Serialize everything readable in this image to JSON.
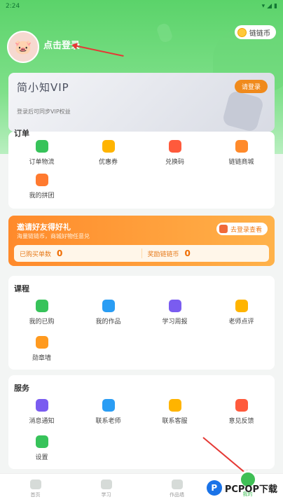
{
  "status": {
    "time": "2:24"
  },
  "header": {
    "login_text": "点击登录",
    "coin_label": "链链币"
  },
  "vip": {
    "title": "简小知VIP",
    "subtitle": "登录后可同步VIP权益",
    "button": "请登录"
  },
  "orders": {
    "title": "订单",
    "items": [
      {
        "label": "订单物流",
        "icon": "order-logistics-icon",
        "color": "#37c35a"
      },
      {
        "label": "优惠券",
        "icon": "coupon-icon",
        "color": "#ffb400"
      },
      {
        "label": "兑换码",
        "icon": "redeem-code-icon",
        "color": "#ff5a3c"
      },
      {
        "label": "链链商城",
        "icon": "shop-icon",
        "color": "#ff8a2b"
      },
      {
        "label": "我的拼团",
        "icon": "group-buy-icon",
        "color": "#ff7a2f"
      }
    ]
  },
  "invite": {
    "title": "邀请好友得好礼",
    "subtitle": "海量链链币，商城好物任意兑",
    "button": "去登录查看",
    "bought_label": "已购买单数",
    "bought_value": "0",
    "reward_label": "奖励链链币",
    "reward_value": "0"
  },
  "course": {
    "title": "课程",
    "items": [
      {
        "label": "我的已购",
        "icon": "purchased-icon",
        "color": "#37c35a"
      },
      {
        "label": "我的作品",
        "icon": "works-icon",
        "color": "#2a9df4"
      },
      {
        "label": "学习周报",
        "icon": "weekly-report-icon",
        "color": "#7a5cf0"
      },
      {
        "label": "老师点评",
        "icon": "teacher-review-icon",
        "color": "#ffb400"
      },
      {
        "label": "勋章墙",
        "icon": "medal-icon",
        "color": "#ff9a1f"
      }
    ]
  },
  "service": {
    "title": "服务",
    "items": [
      {
        "label": "消息通知",
        "icon": "notification-icon",
        "color": "#7a5cf0"
      },
      {
        "label": "联系老师",
        "icon": "contact-teacher-icon",
        "color": "#2a9df4"
      },
      {
        "label": "联系客服",
        "icon": "customer-service-icon",
        "color": "#ffb400"
      },
      {
        "label": "意见反馈",
        "icon": "feedback-icon",
        "color": "#ff5a3c"
      },
      {
        "label": "设置",
        "icon": "settings-icon",
        "color": "#37c35a"
      }
    ]
  },
  "nav": {
    "tabs": [
      {
        "label": "首页",
        "icon": "home-icon"
      },
      {
        "label": "学习",
        "icon": "study-icon"
      },
      {
        "label": "作品墙",
        "icon": "gallery-icon"
      },
      {
        "label": "我的",
        "icon": "profile-icon"
      }
    ]
  },
  "watermark": {
    "text": "PCPOP下载"
  }
}
